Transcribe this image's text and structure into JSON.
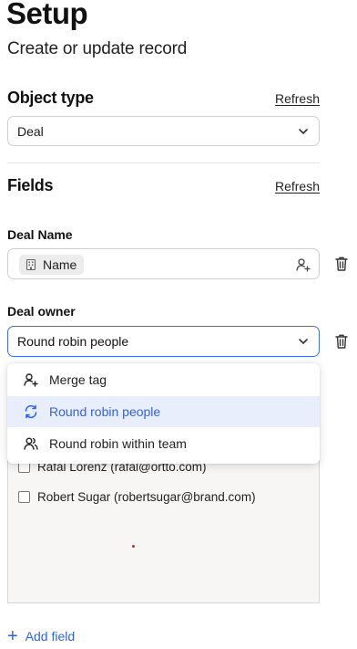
{
  "header": {
    "title": "Setup",
    "subtitle": "Create or update record"
  },
  "object_type": {
    "heading": "Object type",
    "refresh_label": "Refresh",
    "selected": "Deal"
  },
  "fields": {
    "heading": "Fields",
    "refresh_label": "Refresh",
    "deal_name": {
      "label": "Deal Name",
      "chip_label": "Name"
    },
    "deal_owner": {
      "label": "Deal owner",
      "selected": "Round robin people"
    }
  },
  "dropdown_menu": {
    "items": [
      {
        "label": "Merge tag",
        "icon": "person-add-icon",
        "selected": false
      },
      {
        "label": "Round robin people",
        "icon": "rotate-icon",
        "selected": true
      },
      {
        "label": "Round robin within team",
        "icon": "team-icon",
        "selected": false
      }
    ]
  },
  "people_list": {
    "items": [
      {
        "label": "Rafal Lorenz (rafal@ortto.com)",
        "checked": false
      },
      {
        "label": "Robert Sugar (robertsugar@brand.com)",
        "checked": false
      }
    ]
  },
  "footer": {
    "add_field_label": "Add field"
  },
  "colors": {
    "accent": "#2d63e8",
    "selected_bg": "#e8eefc",
    "panel_bg": "#f7f6f5"
  }
}
